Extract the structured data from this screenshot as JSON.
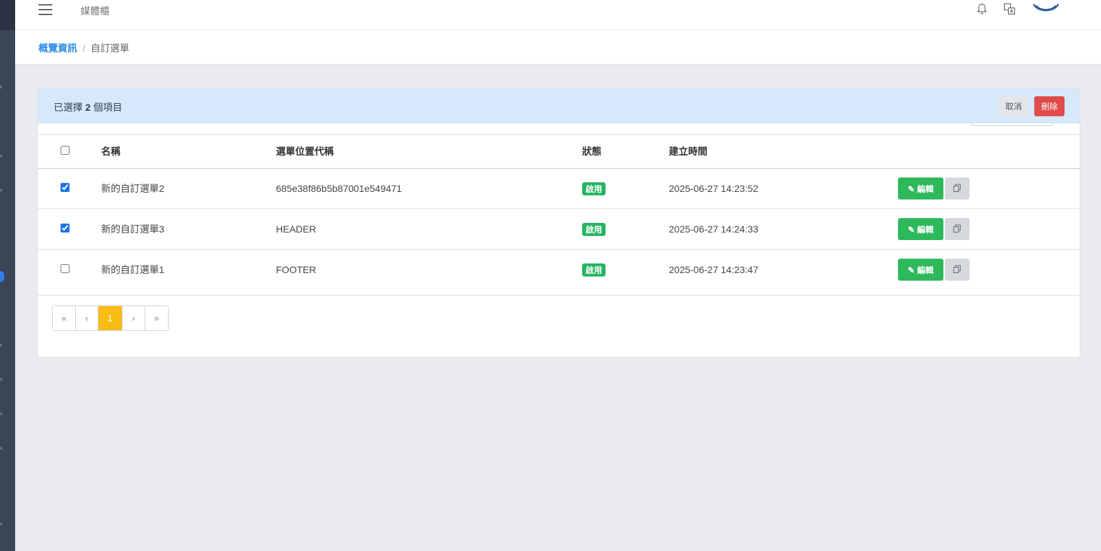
{
  "header": {
    "site_title": "媒體櫃"
  },
  "breadcrumb": {
    "home": "概覽資訊",
    "separator": "/",
    "current": "自訂選單"
  },
  "selection": {
    "prefix": "已選擇",
    "count": "2",
    "suffix": "個項目",
    "cancel_label": "取消",
    "delete_label": "刪除"
  },
  "table": {
    "headers": {
      "name": "名稱",
      "code": "選單位置代稱",
      "status": "狀態",
      "created": "建立時間"
    },
    "rows": [
      {
        "checked": true,
        "name": "新的自訂選單2",
        "code": "685e38f86b5b87001e549471",
        "status": "啟用",
        "created": "2025-06-27 14:23:52",
        "edit_label": "編輯"
      },
      {
        "checked": true,
        "name": "新的自訂選單3",
        "code": "HEADER",
        "status": "啟用",
        "created": "2025-06-27 14:24:33",
        "edit_label": "編輯"
      },
      {
        "checked": false,
        "name": "新的自訂選單1",
        "code": "FOOTER",
        "status": "啟用",
        "created": "2025-06-27 14:23:47",
        "edit_label": "編輯"
      }
    ]
  },
  "pagination": {
    "first": "«",
    "prev": "‹",
    "current": "1",
    "next": "›",
    "last": "»"
  },
  "colors": {
    "accent_blue": "#2b8be6",
    "success_green": "#2eb85c",
    "danger_red": "#e04b4b",
    "page_active": "#f8bd14",
    "selection_bg": "#d6e9fb"
  },
  "icons": [
    "menu-icon",
    "bell-icon",
    "translate-icon",
    "logo",
    "pencil-icon",
    "copy-icon",
    "chevron-icon"
  ]
}
